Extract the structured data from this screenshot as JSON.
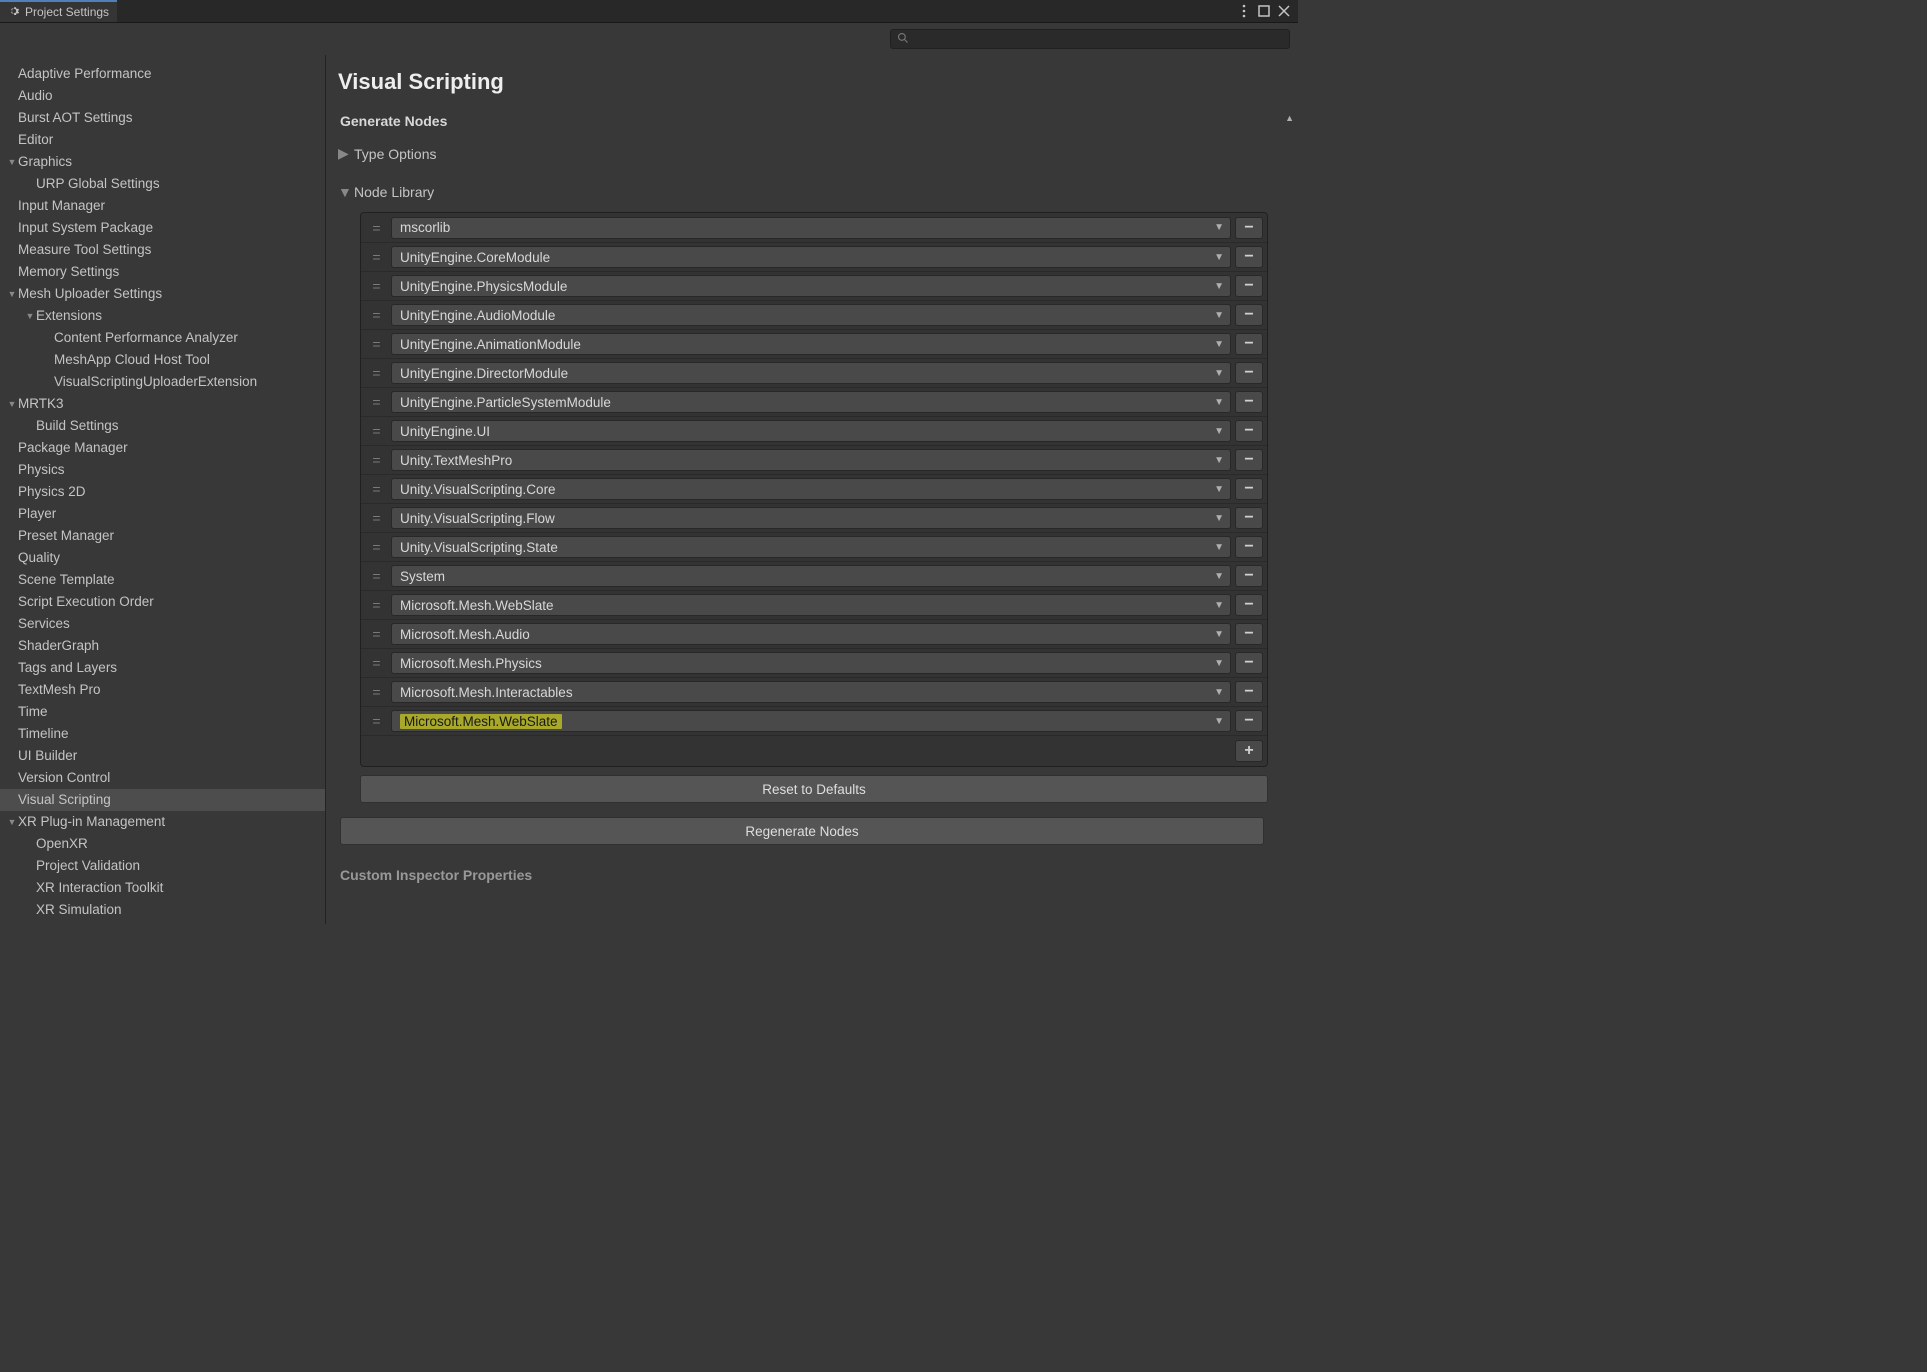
{
  "tab": {
    "title": "Project Settings"
  },
  "search": {
    "placeholder": ""
  },
  "sidebar": [
    {
      "label": "Adaptive Performance",
      "indent": 1,
      "arrow": ""
    },
    {
      "label": "Audio",
      "indent": 1,
      "arrow": ""
    },
    {
      "label": "Burst AOT Settings",
      "indent": 1,
      "arrow": ""
    },
    {
      "label": "Editor",
      "indent": 1,
      "arrow": ""
    },
    {
      "label": "Graphics",
      "indent": 1,
      "arrow": "▼"
    },
    {
      "label": "URP Global Settings",
      "indent": 2,
      "arrow": ""
    },
    {
      "label": "Input Manager",
      "indent": 1,
      "arrow": ""
    },
    {
      "label": "Input System Package",
      "indent": 1,
      "arrow": ""
    },
    {
      "label": "Measure Tool Settings",
      "indent": 1,
      "arrow": ""
    },
    {
      "label": "Memory Settings",
      "indent": 1,
      "arrow": ""
    },
    {
      "label": "Mesh Uploader Settings",
      "indent": 1,
      "arrow": "▼"
    },
    {
      "label": "Extensions",
      "indent": 2,
      "arrow": "▼"
    },
    {
      "label": "Content Performance Analyzer",
      "indent": 3,
      "arrow": ""
    },
    {
      "label": "MeshApp Cloud Host Tool",
      "indent": 3,
      "arrow": ""
    },
    {
      "label": "VisualScriptingUploaderExtension",
      "indent": 3,
      "arrow": ""
    },
    {
      "label": "MRTK3",
      "indent": 1,
      "arrow": "▼"
    },
    {
      "label": "Build Settings",
      "indent": 2,
      "arrow": ""
    },
    {
      "label": "Package Manager",
      "indent": 1,
      "arrow": ""
    },
    {
      "label": "Physics",
      "indent": 1,
      "arrow": ""
    },
    {
      "label": "Physics 2D",
      "indent": 1,
      "arrow": ""
    },
    {
      "label": "Player",
      "indent": 1,
      "arrow": ""
    },
    {
      "label": "Preset Manager",
      "indent": 1,
      "arrow": ""
    },
    {
      "label": "Quality",
      "indent": 1,
      "arrow": ""
    },
    {
      "label": "Scene Template",
      "indent": 1,
      "arrow": ""
    },
    {
      "label": "Script Execution Order",
      "indent": 1,
      "arrow": ""
    },
    {
      "label": "Services",
      "indent": 1,
      "arrow": ""
    },
    {
      "label": "ShaderGraph",
      "indent": 1,
      "arrow": ""
    },
    {
      "label": "Tags and Layers",
      "indent": 1,
      "arrow": ""
    },
    {
      "label": "TextMesh Pro",
      "indent": 1,
      "arrow": ""
    },
    {
      "label": "Time",
      "indent": 1,
      "arrow": ""
    },
    {
      "label": "Timeline",
      "indent": 1,
      "arrow": ""
    },
    {
      "label": "UI Builder",
      "indent": 1,
      "arrow": ""
    },
    {
      "label": "Version Control",
      "indent": 1,
      "arrow": ""
    },
    {
      "label": "Visual Scripting",
      "indent": 1,
      "arrow": "",
      "selected": true
    },
    {
      "label": "XR Plug-in Management",
      "indent": 1,
      "arrow": "▼"
    },
    {
      "label": "OpenXR",
      "indent": 2,
      "arrow": ""
    },
    {
      "label": "Project Validation",
      "indent": 2,
      "arrow": ""
    },
    {
      "label": "XR Interaction Toolkit",
      "indent": 2,
      "arrow": ""
    },
    {
      "label": "XR Simulation",
      "indent": 2,
      "arrow": ""
    }
  ],
  "main": {
    "title": "Visual Scripting",
    "generate_title": "Generate Nodes",
    "type_options": "Type Options",
    "node_library": "Node Library",
    "reset_btn": "Reset to Defaults",
    "regenerate_btn": "Regenerate Nodes",
    "custom_title": "Custom Inspector Properties",
    "libraries": [
      {
        "name": "mscorlib"
      },
      {
        "name": "UnityEngine.CoreModule"
      },
      {
        "name": "UnityEngine.PhysicsModule"
      },
      {
        "name": "UnityEngine.AudioModule"
      },
      {
        "name": "UnityEngine.AnimationModule"
      },
      {
        "name": "UnityEngine.DirectorModule"
      },
      {
        "name": "UnityEngine.ParticleSystemModule"
      },
      {
        "name": "UnityEngine.UI"
      },
      {
        "name": "Unity.TextMeshPro"
      },
      {
        "name": "Unity.VisualScripting.Core"
      },
      {
        "name": "Unity.VisualScripting.Flow"
      },
      {
        "name": "Unity.VisualScripting.State"
      },
      {
        "name": "System"
      },
      {
        "name": "Microsoft.Mesh.WebSlate"
      },
      {
        "name": "Microsoft.Mesh.Audio"
      },
      {
        "name": "Microsoft.Mesh.Physics"
      },
      {
        "name": "Microsoft.Mesh.Interactables"
      },
      {
        "name": "Microsoft.Mesh.WebSlate",
        "highlight": true
      }
    ]
  }
}
